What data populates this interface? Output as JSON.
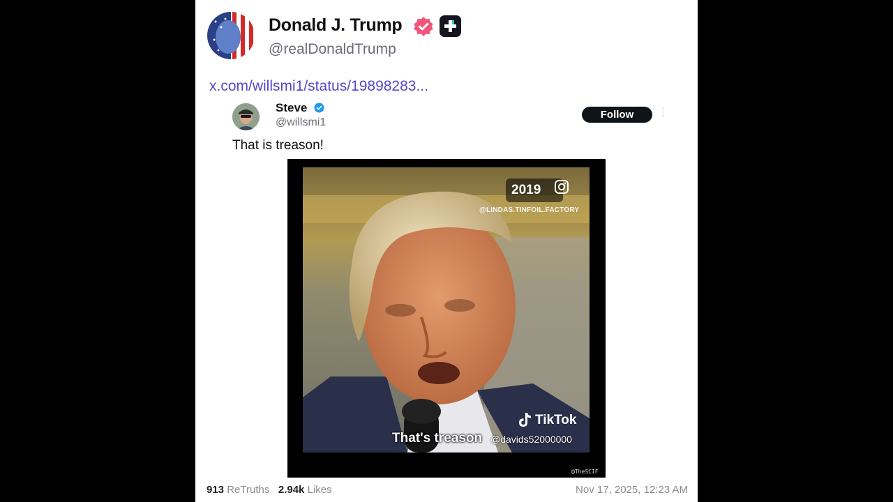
{
  "post": {
    "author_name": "Donald J. Trump",
    "author_handle": "@realDonaldTrump",
    "avatar_icon": "flag-face-avatar",
    "verified_icon": "pink-verified-badge",
    "plus_icon": "plus-badge",
    "link_text": "x.com/willsmi1/status/19898283...",
    "retruths_count": "913",
    "retruths_label": "ReTruths",
    "likes_count": "2.94k",
    "likes_label": "Likes",
    "timestamp": "Nov 17, 2025, 12:23 AM"
  },
  "embed": {
    "name": "Steve",
    "handle": "@willsmi1",
    "follow_label": "Follow",
    "more_label": "⋮",
    "text": "That is treason!",
    "video": {
      "year": "2019",
      "ig_tag": "@LINDAS.TINFOIL.FACTORY",
      "tiktok_label": "TikTok",
      "tiktok_handle": "@davids52000000",
      "caption": "That's treason",
      "watermark": "@TheSCIF"
    }
  },
  "colors": {
    "link": "#5448c8",
    "verified_pink": "#f0567a",
    "embed_verified_blue": "#1d9bf0",
    "follow_bg": "#0f1419"
  }
}
